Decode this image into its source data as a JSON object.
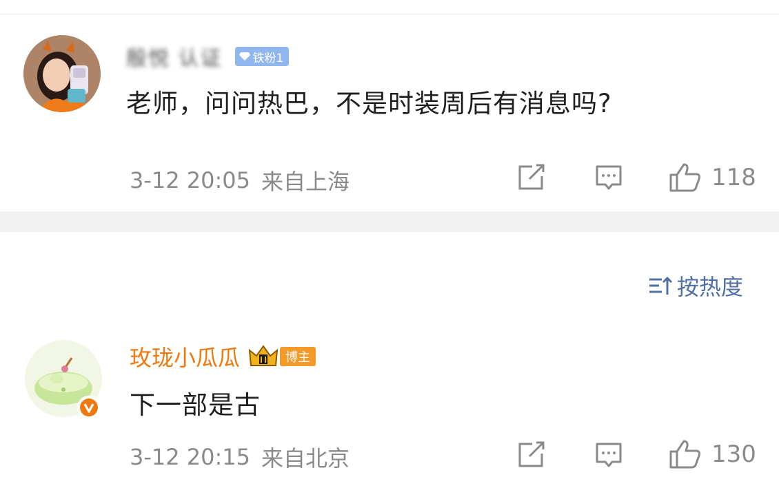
{
  "comments": [
    {
      "username": "殷悦 认证",
      "fan_badge": "铁粉1",
      "text": "老师，问问热巴，不是时装周后有消息吗?",
      "time": "3-12 20:05",
      "location": "来自上海",
      "likes": "118"
    },
    {
      "username": "玫珑小瓜瓜",
      "badge": "博主",
      "text": "下一部是古",
      "time": "3-12 20:15",
      "location": "来自北京",
      "likes": "130"
    }
  ],
  "sort": {
    "label": "按热度"
  },
  "icons": {
    "repost": "repost-icon",
    "comment": "comment-icon",
    "like": "thumbs-up-icon",
    "sort": "sort-icon",
    "crown": "crown-icon",
    "verified": "verified-v-icon"
  },
  "colors": {
    "username_accent": "#f0790f",
    "fan_badge": "#8fb6ef",
    "sort_link": "#4f6fa5",
    "blogger_badge": "#f39a2a",
    "meta_gray": "#8a8a8a"
  }
}
